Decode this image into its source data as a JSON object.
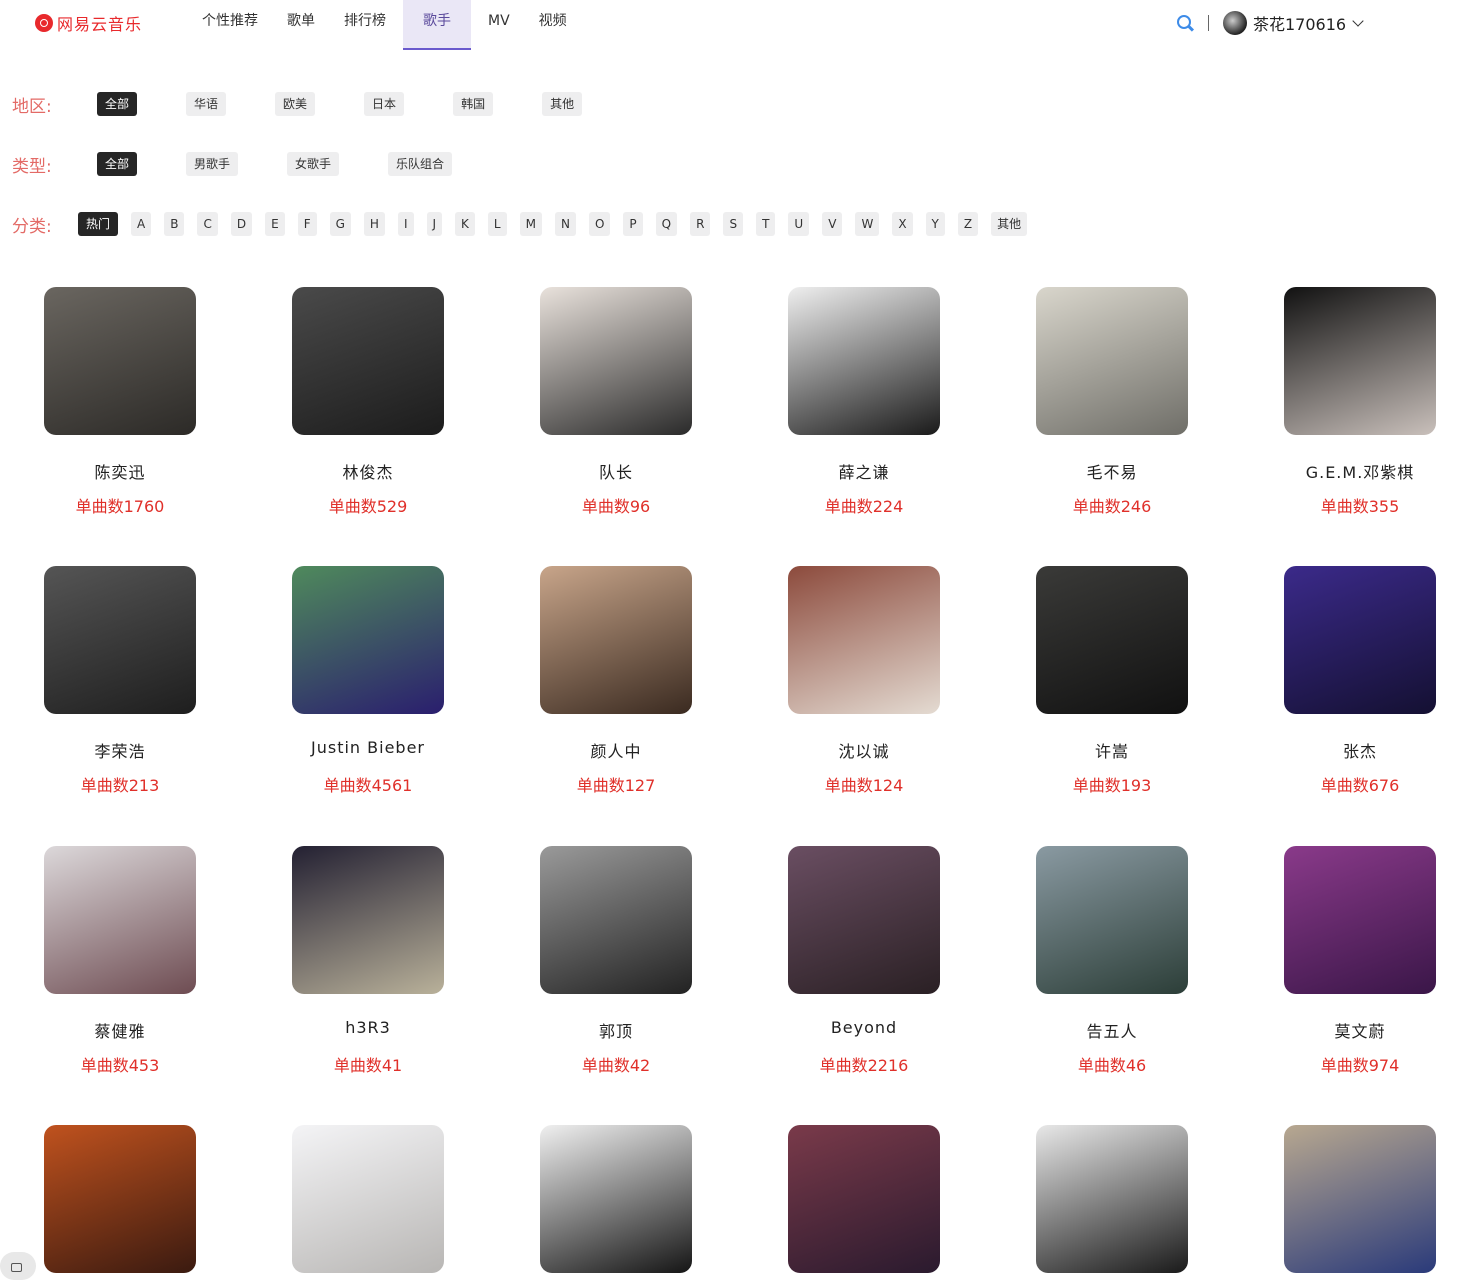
{
  "app": {
    "logo_text": "网易云音乐",
    "brand_color": "#e8292c",
    "accent_color": "#6a5acd",
    "count_color": "#e0302a"
  },
  "nav": {
    "items": [
      "个性推荐",
      "歌单",
      "排行榜",
      "歌手",
      "MV",
      "视频"
    ],
    "active": "歌手"
  },
  "user": {
    "name": "茶花170616",
    "search_icon": "search-icon"
  },
  "filters": {
    "region": {
      "label": "地区:",
      "options": [
        "全部",
        "华语",
        "欧美",
        "日本",
        "韩国",
        "其他"
      ],
      "active": "全部"
    },
    "type": {
      "label": "类型:",
      "options": [
        "全部",
        "男歌手",
        "女歌手",
        "乐队组合"
      ],
      "active": "全部"
    },
    "letter": {
      "label": "分类:",
      "options": [
        "热门",
        "A",
        "B",
        "C",
        "D",
        "E",
        "F",
        "G",
        "H",
        "I",
        "J",
        "K",
        "L",
        "M",
        "N",
        "O",
        "P",
        "Q",
        "R",
        "S",
        "T",
        "U",
        "V",
        "W",
        "X",
        "Y",
        "Z",
        "其他"
      ],
      "active": "热门"
    }
  },
  "artists": [
    {
      "name": "陈奕迅",
      "count": "单曲数1760",
      "tone": [
        "#6a6660",
        "#2c2a27"
      ]
    },
    {
      "name": "林俊杰",
      "count": "单曲数529",
      "tone": [
        "#4a4a4a",
        "#1c1c1c"
      ]
    },
    {
      "name": "队长",
      "count": "单曲数96",
      "tone": [
        "#e9e2dc",
        "#2a2a2a"
      ]
    },
    {
      "name": "薛之谦",
      "count": "单曲数224",
      "tone": [
        "#efefef",
        "#1a1a1a"
      ]
    },
    {
      "name": "毛不易",
      "count": "单曲数246",
      "tone": [
        "#d9d6cc",
        "#6f6e68"
      ]
    },
    {
      "name": "G.E.M.邓紫棋",
      "count": "单曲数355",
      "tone": [
        "#111111",
        "#c9c0bb"
      ]
    },
    {
      "name": "李荣浩",
      "count": "单曲数213",
      "tone": [
        "#555555",
        "#1e1e1e"
      ]
    },
    {
      "name": "Justin Bieber",
      "count": "单曲数4561",
      "tone": [
        "#4f8a5c",
        "#2a1e6e"
      ]
    },
    {
      "name": "颜人中",
      "count": "单曲数127",
      "tone": [
        "#c8a58a",
        "#3a2a20"
      ]
    },
    {
      "name": "沈以诚",
      "count": "单曲数124",
      "tone": [
        "#8c4a3c",
        "#e4dbd2"
      ]
    },
    {
      "name": "许嵩",
      "count": "单曲数193",
      "tone": [
        "#3a3a38",
        "#111111"
      ]
    },
    {
      "name": "张杰",
      "count": "单曲数676",
      "tone": [
        "#3b2a8a",
        "#141032"
      ]
    },
    {
      "name": "蔡健雅",
      "count": "单曲数453",
      "tone": [
        "#dcd8da",
        "#6e4c52"
      ]
    },
    {
      "name": "h3R3",
      "count": "单曲数41",
      "tone": [
        "#232032",
        "#b9b19a"
      ]
    },
    {
      "name": "郭顶",
      "count": "单曲数42",
      "tone": [
        "#9a9a9a",
        "#222222"
      ]
    },
    {
      "name": "Beyond",
      "count": "单曲数2216",
      "tone": [
        "#6a4e62",
        "#2a2024"
      ]
    },
    {
      "name": "告五人",
      "count": "单曲数46",
      "tone": [
        "#8a9aa2",
        "#2c3e38"
      ]
    },
    {
      "name": "莫文蔚",
      "count": "单曲数974",
      "tone": [
        "#8a3a8a",
        "#3a1648"
      ]
    },
    {
      "name": "",
      "count": "",
      "tone": [
        "#c0521e",
        "#3a1a10"
      ]
    },
    {
      "name": "",
      "count": "",
      "tone": [
        "#f4f4f6",
        "#b8b6b4"
      ]
    },
    {
      "name": "",
      "count": "",
      "tone": [
        "#f0f0f0",
        "#151515"
      ]
    },
    {
      "name": "",
      "count": "",
      "tone": [
        "#7a3a4a",
        "#2a1a2e"
      ]
    },
    {
      "name": "",
      "count": "",
      "tone": [
        "#e8e8e8",
        "#1a1a1a"
      ]
    },
    {
      "name": "",
      "count": "",
      "tone": [
        "#b8a890",
        "#2a3a7a"
      ]
    }
  ]
}
